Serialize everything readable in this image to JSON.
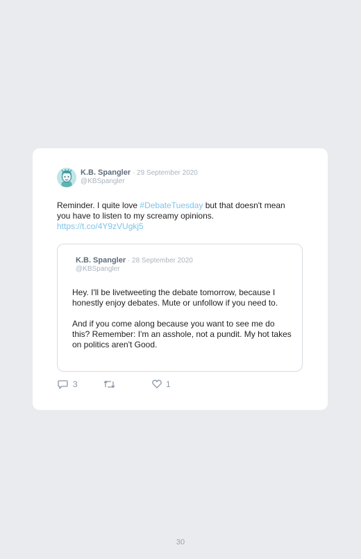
{
  "tweet": {
    "author": "K.B. Spangler",
    "date_sep": " · ",
    "date": "29 September 2020",
    "handle": "@KBSpangler",
    "text_before": "Reminder. I quite love ",
    "hashtag": "#DebateTuesday",
    "text_after": " but that doesn't mean you have to listen to my screamy opinions.",
    "link": "https://t.co/4Y9zVUgkj5"
  },
  "quoted_tweet": {
    "author": "K.B. Spangler",
    "date_sep": " · ",
    "date": "28 September 2020",
    "handle": "@KBSpangler",
    "paragraph_1": "Hey. I'll be livetweeting the debate tomorrow, because I honestly enjoy debates. Mute or unfollow if you need to.",
    "paragraph_2": "And if you come along because you want to see me do this? Remember: I'm an asshole, not a pundit. My hot takes on politics aren't Good."
  },
  "actions": {
    "reply_icon": "reply-icon",
    "reply_count": "3",
    "retweet_icon": "retweet-icon",
    "like_icon": "heart-icon",
    "like_count": "1"
  },
  "page_number": "30",
  "colors": {
    "background": "#e9ebee",
    "card": "#ffffff",
    "link": "#7fc3e9",
    "author": "#5e6b7a",
    "muted": "#aab4be"
  }
}
